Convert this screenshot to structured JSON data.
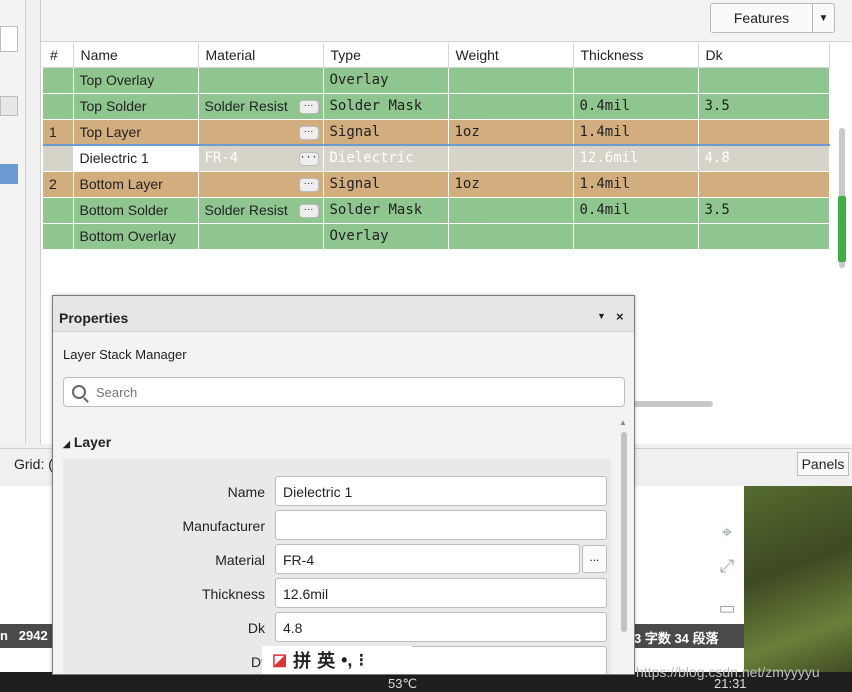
{
  "toolbar": {
    "features_label": "Features"
  },
  "table": {
    "headers": [
      "#",
      "Name",
      "Material",
      "Type",
      "Weight",
      "Thickness",
      "Dk"
    ],
    "rows": [
      {
        "num": "",
        "name": "Top Overlay",
        "material": "",
        "type": "Overlay",
        "weight": "",
        "thickness": "",
        "dk": ""
      },
      {
        "num": "",
        "name": "Top Solder",
        "material": "Solder Resist",
        "type": "Solder Mask",
        "weight": "",
        "thickness": "0.4mil",
        "dk": "3.5"
      },
      {
        "num": "1",
        "name": "Top Layer",
        "material": "",
        "type": "Signal",
        "weight": "1oz",
        "thickness": "1.4mil",
        "dk": ""
      },
      {
        "num": "",
        "name": "Dielectric 1",
        "material": "FR-4",
        "type": "Dielectric",
        "weight": "",
        "thickness": "12.6mil",
        "dk": "4.8"
      },
      {
        "num": "2",
        "name": "Bottom Layer",
        "material": "",
        "type": "Signal",
        "weight": "1oz",
        "thickness": "1.4mil",
        "dk": ""
      },
      {
        "num": "",
        "name": "Bottom Solder",
        "material": "Solder Resist",
        "type": "Solder Mask",
        "weight": "",
        "thickness": "0.4mil",
        "dk": "3.5"
      },
      {
        "num": "",
        "name": "Bottom Overlay",
        "material": "",
        "type": "Overlay",
        "weight": "",
        "thickness": "",
        "dk": ""
      }
    ],
    "more_label": "···"
  },
  "status": {
    "grid_label": "Grid: (",
    "panels_label": "Panels"
  },
  "properties": {
    "title": "Properties",
    "pin_icon": "▼",
    "close_icon": "×",
    "subtitle": "Layer Stack Manager",
    "search_placeholder": "Search",
    "section_label": "Layer",
    "section_toggle": "◢",
    "fields": {
      "name_label": "Name",
      "name_value": "Dielectric 1",
      "manufacturer_label": "Manufacturer",
      "manufacturer_value": "",
      "material_label": "Material",
      "material_value": "FR-4",
      "material_btn": "...",
      "thickness_label": "Thickness",
      "thickness_value": "12.6mil",
      "dk_label": "Dk",
      "dk_value": "4.8",
      "df_label": "Df",
      "df_value": ""
    }
  },
  "background": {
    "word_left_label": "n",
    "word_left_value": "2942",
    "word_right": "3 字数  34 段落",
    "temp": "53℃",
    "time": "21:31",
    "watermark": "https://blog.csdn.net/zmyyyyu"
  },
  "ime": {
    "items": [
      "拼",
      "英",
      "•,",
      "⁝"
    ]
  },
  "colors": {
    "green_row": "#8fc68f",
    "orange_row": "#d2ad7d",
    "selected_border": "#6b9bd1"
  }
}
